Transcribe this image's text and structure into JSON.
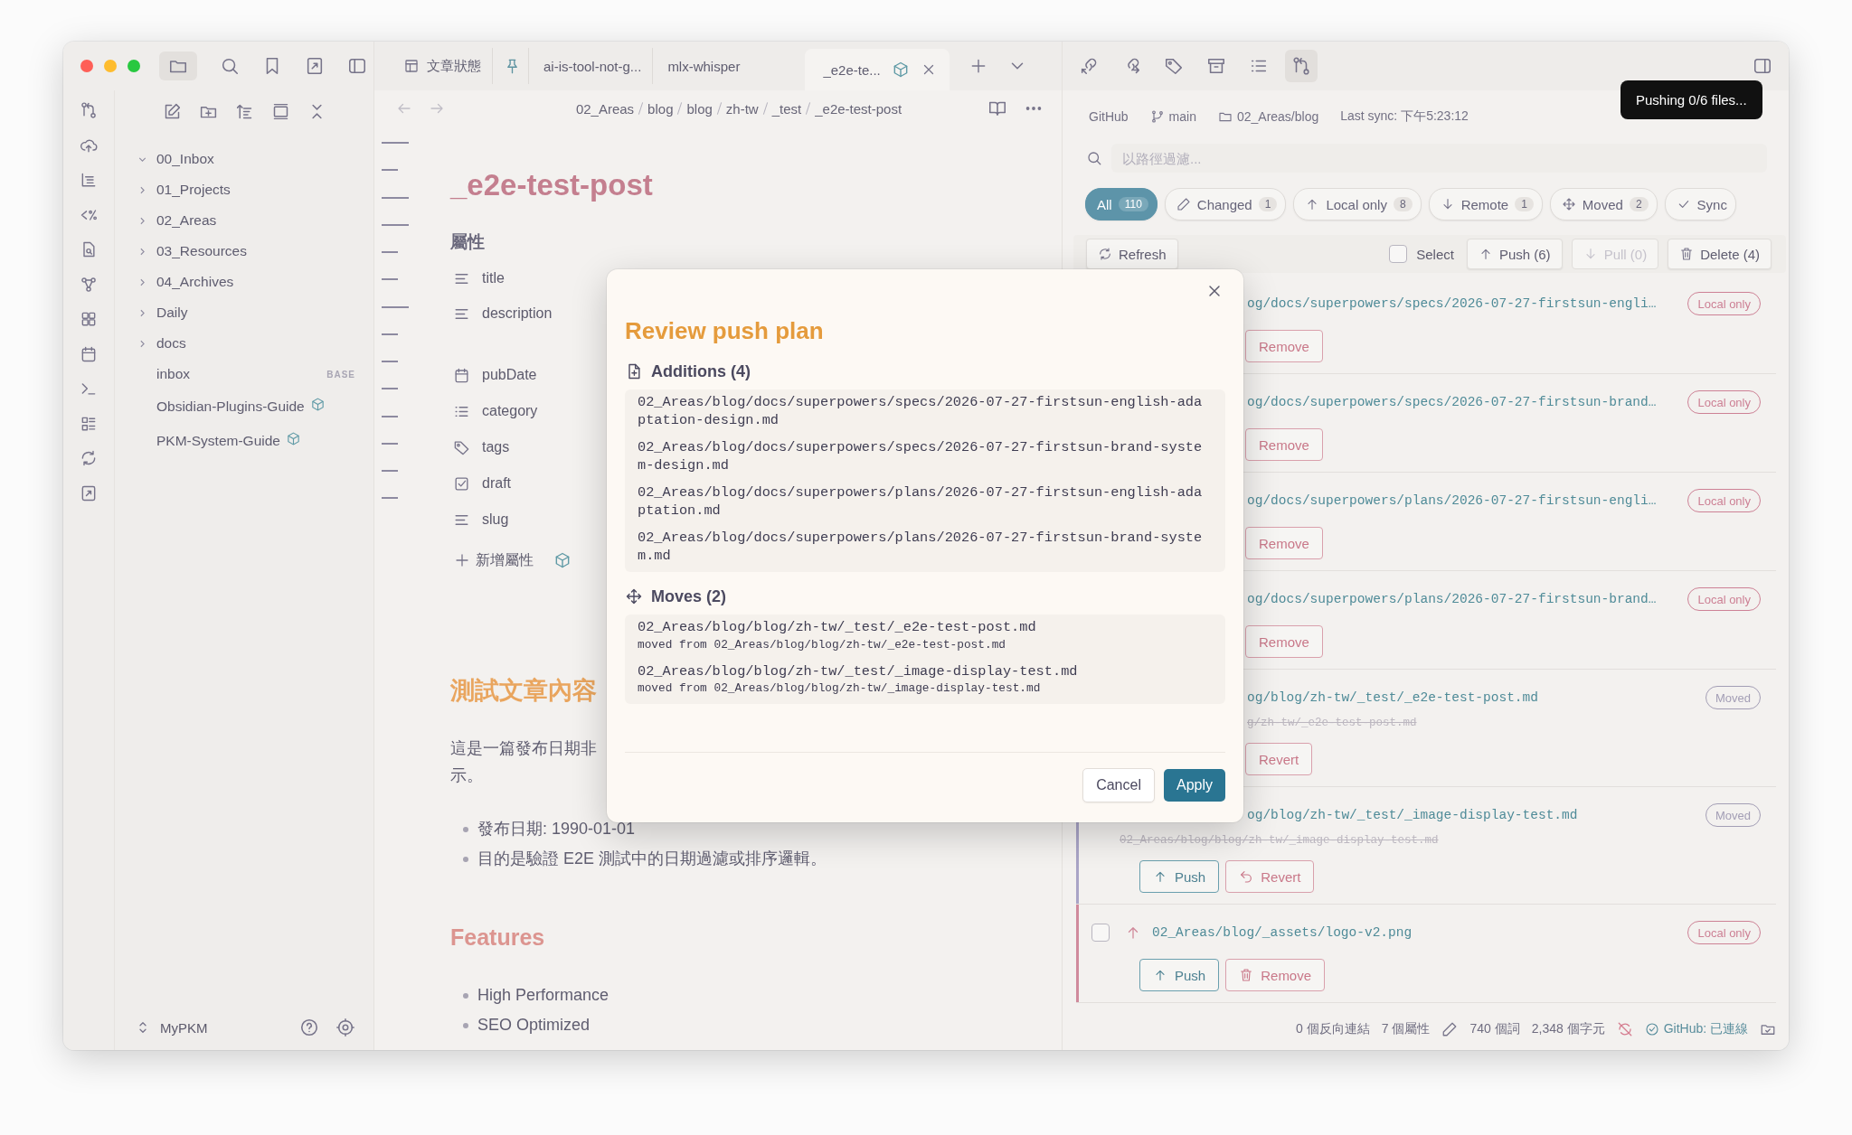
{
  "file_tree": {
    "items": [
      {
        "label": "00_Inbox",
        "kind": "folder",
        "expanded": true
      },
      {
        "label": "01_Projects",
        "kind": "folder",
        "expanded": false
      },
      {
        "label": "02_Areas",
        "kind": "folder",
        "expanded": false
      },
      {
        "label": "03_Resources",
        "kind": "folder",
        "expanded": false
      },
      {
        "label": "04_Archives",
        "kind": "folder",
        "expanded": false
      },
      {
        "label": "Daily",
        "kind": "folder",
        "expanded": false
      },
      {
        "label": "docs",
        "kind": "folder",
        "expanded": false
      },
      {
        "label": "inbox",
        "kind": "base",
        "badge": "BASE"
      },
      {
        "label": "Obsidian-Plugins-Guide",
        "kind": "package"
      },
      {
        "label": "PKM-System-Guide",
        "kind": "package"
      }
    ]
  },
  "vault": {
    "name": "MyPKM"
  },
  "tabs": [
    {
      "kind": "table",
      "label": "文章狀態",
      "selected": false
    },
    {
      "kind": "pinned",
      "selected": false
    },
    {
      "kind": "note",
      "label": "ai-is-tool-not-g...",
      "selected": false
    },
    {
      "kind": "note",
      "label": "mlx-whisper",
      "selected": false
    },
    {
      "kind": "package",
      "label": "_e2e-te...",
      "selected": true
    }
  ],
  "breadcrumbs": [
    "02_Areas",
    "blog",
    "blog",
    "zh-tw",
    "_test",
    "_e2e-test-post"
  ],
  "note": {
    "title": "_e2e-test-post",
    "properties_heading": "屬性",
    "properties": [
      {
        "name": "title",
        "kind": "text"
      },
      {
        "name": "description",
        "kind": "multiline"
      },
      {
        "name": "pubDate",
        "kind": "date"
      },
      {
        "name": "category",
        "kind": "list"
      },
      {
        "name": "tags",
        "kind": "tags"
      },
      {
        "name": "draft",
        "kind": "checkbox"
      },
      {
        "name": "slug",
        "kind": "text"
      }
    ],
    "add_property": "新增屬性",
    "body": [
      {
        "kind": "h2",
        "text": "測試文章內容"
      },
      {
        "kind": "paragraph",
        "lines": [
          "這是一篇發布日期非",
          "示。"
        ]
      },
      {
        "kind": "bullets",
        "items": [
          "發布日期: 1990-01-01",
          "目的是驗證 E2E 測試中的日期過濾或排序邏輯。"
        ]
      },
      {
        "kind": "h3",
        "text": "Features"
      },
      {
        "kind": "bullets",
        "items": [
          "High Performance",
          "SEO Optimized"
        ]
      }
    ]
  },
  "right_panel": {
    "tools": [
      {
        "kind": "link-in",
        "selected": false
      },
      {
        "kind": "link-out",
        "selected": false
      },
      {
        "kind": "tag",
        "selected": false
      },
      {
        "kind": "archive",
        "selected": false
      },
      {
        "kind": "list",
        "selected": false
      },
      {
        "kind": "git",
        "selected": true
      }
    ],
    "repo": {
      "provider": "GitHub",
      "branch": "main",
      "folder": "02_Areas/blog",
      "last_sync": "Last sync: 下午5:23:12"
    },
    "filter": {
      "placeholder": "以路徑過濾..."
    },
    "chips": [
      {
        "kind": "all",
        "label": "All",
        "count": "110",
        "selected": true
      },
      {
        "kind": "changed",
        "label": "Changed",
        "count": "1",
        "selected": false
      },
      {
        "kind": "local",
        "label": "Local only",
        "count": "8",
        "selected": false
      },
      {
        "kind": "remote",
        "label": "Remote",
        "count": "1",
        "selected": false
      },
      {
        "kind": "moved",
        "label": "Moved",
        "count": "2",
        "selected": false
      },
      {
        "kind": "synced",
        "label": "Sync",
        "selected": false
      }
    ],
    "actions": {
      "refresh": "Refresh",
      "select": {
        "label": "Select",
        "checked": false
      },
      "push": "Push (6)",
      "pull": {
        "label": "Pull (0)",
        "disabled": true
      },
      "delete": "Delete (4)"
    },
    "files": [
      {
        "kind": "covered",
        "path": "og/docs/superpowers/specs/2026-07-27-firstsun-engli…",
        "status": {
          "label": "Local only",
          "color": "#cd8195"
        },
        "actions": [
          {
            "kind": "remove",
            "label": "Remove"
          }
        ]
      },
      {
        "kind": "covered",
        "path": "og/docs/superpowers/specs/2026-07-27-firstsun-brand…",
        "status": {
          "label": "Local only",
          "color": "#cd8195"
        },
        "actions": [
          {
            "kind": "remove",
            "label": "Remove"
          }
        ]
      },
      {
        "kind": "covered",
        "path": "og/docs/superpowers/plans/2026-07-27-firstsun-engli…",
        "status": {
          "label": "Local only",
          "color": "#cd8195"
        },
        "actions": [
          {
            "kind": "remove",
            "label": "Remove"
          }
        ]
      },
      {
        "kind": "covered",
        "path": "og/docs/superpowers/plans/2026-07-27-firstsun-brand…",
        "status": {
          "label": "Local only",
          "color": "#cd8195"
        },
        "actions": [
          {
            "kind": "remove",
            "label": "Remove"
          }
        ]
      },
      {
        "kind": "covered",
        "path": "og/blog/zh-tw/_test/_e2e-test-post.md",
        "old_path": "g/zh-tw/_e2e-test-post.md",
        "status": {
          "label": "Moved",
          "color": "#a39eb5"
        },
        "actions": [
          {
            "kind": "revert",
            "label": "Revert"
          }
        ]
      },
      {
        "kind": "path-covered",
        "color": "#a9a4c6",
        "path": "og/blog/zh-tw/_test/_image-display-test.md",
        "old_path": "02_Areas/blog/blog/zh-tw/_image-display-test.md",
        "status": {
          "label": "Moved",
          "color": "#a39eb5"
        },
        "actions": [
          {
            "kind": "push",
            "label": "Push"
          },
          {
            "kind": "revert",
            "label": "Revert"
          }
        ]
      },
      {
        "kind": "full",
        "color": "#d08a9c",
        "checked": false,
        "path": "02_Areas/blog/_assets/logo-v2.png",
        "status": {
          "label": "Local only",
          "color": "#cd8195"
        },
        "actions": [
          {
            "kind": "push",
            "label": "Push"
          },
          {
            "kind": "remove",
            "label": "Remove"
          }
        ]
      }
    ],
    "status_bar": {
      "backlinks": "0 個反向連結",
      "properties": "7 個屬性",
      "words": "740 個詞",
      "chars": "2,348 個字元",
      "github": "GitHub: 已連線"
    }
  },
  "toast": "Pushing 0/6 files...",
  "modal": {
    "title": "Review push plan",
    "sections": [
      {
        "kind": "additions",
        "heading": "Additions (4)",
        "entries": [
          {
            "path": "02_Areas/blog/docs/superpowers/specs/2026-07-27-firstsun-english-adaptation-design.md"
          },
          {
            "path": "02_Areas/blog/docs/superpowers/specs/2026-07-27-firstsun-brand-system-design.md"
          },
          {
            "path": "02_Areas/blog/docs/superpowers/plans/2026-07-27-firstsun-english-adaptation.md"
          },
          {
            "path": "02_Areas/blog/docs/superpowers/plans/2026-07-27-firstsun-brand-system.md"
          }
        ]
      },
      {
        "kind": "moves",
        "heading": "Moves (2)",
        "entries": [
          {
            "path": "02_Areas/blog/blog/zh-tw/_test/_e2e-test-post.md",
            "from": "moved from 02_Areas/blog/blog/zh-tw/_e2e-test-post.md"
          },
          {
            "path": "02_Areas/blog/blog/zh-tw/_test/_image-display-test.md",
            "from": "moved from 02_Areas/blog/blog/zh-tw/_image-display-test.md"
          }
        ]
      }
    ],
    "buttons": [
      {
        "kind": "secondary",
        "label": "Cancel"
      },
      {
        "kind": "primary",
        "label": "Apply"
      }
    ]
  }
}
